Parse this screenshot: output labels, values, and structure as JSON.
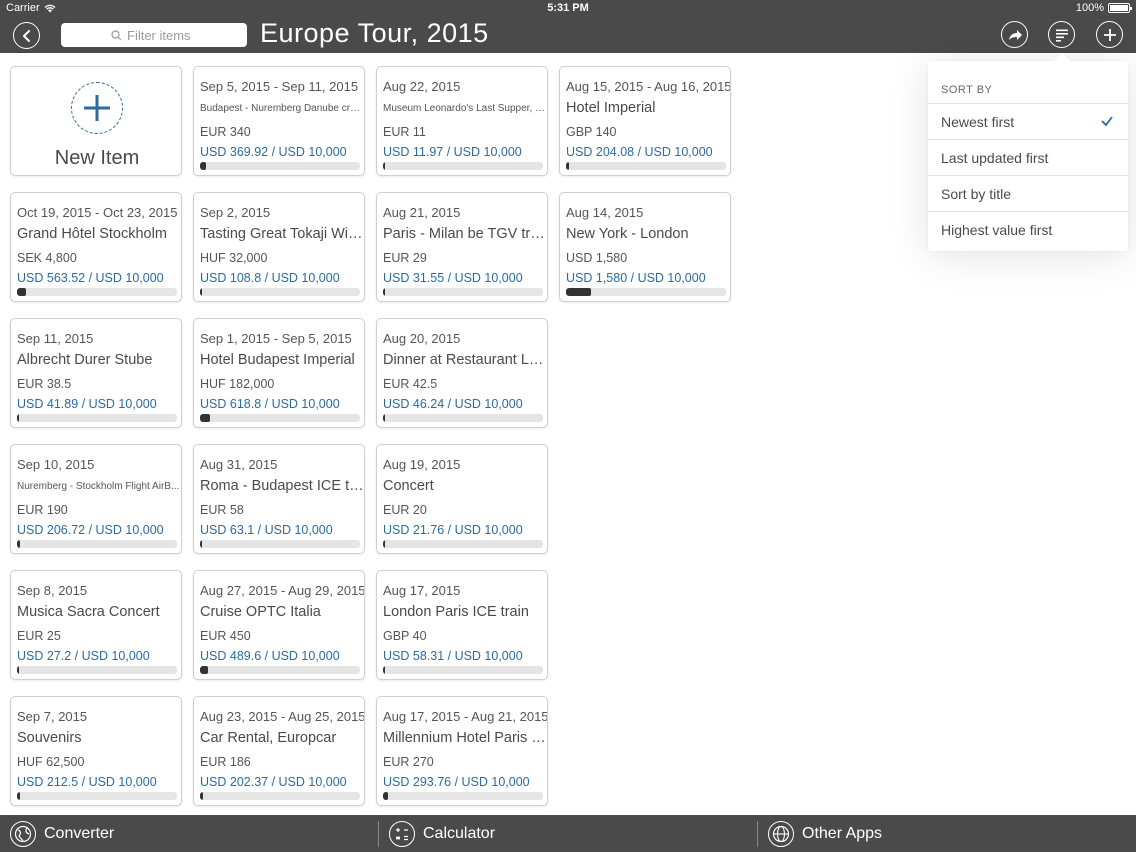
{
  "status_bar": {
    "carrier": "Carrier",
    "time": "5:31 PM",
    "battery": "100%"
  },
  "nav": {
    "title": "Europe Tour, 2015",
    "filter_placeholder": "Filter items"
  },
  "new_item_label": "New Item",
  "items": [
    {
      "date": "Sep 5, 2015 - Sep 11, 2015",
      "title": "Budapest - Nuremberg Danube cruise",
      "amount": "EUR 340",
      "usd": "USD 369.92 / USD 10,000",
      "progress": 0.037
    },
    {
      "date": "Aug 22, 2015",
      "title": "Museum Leonardo's Last Supper, M...",
      "amount": "EUR 11",
      "usd": "USD 11.97 / USD 10,000",
      "progress": 0.0012
    },
    {
      "date": "Aug 15, 2015 - Aug 16, 2015",
      "title": "Hotel Imperial",
      "amount": "GBP 140",
      "usd": "USD 204.08 / USD 10,000",
      "progress": 0.0204
    },
    {
      "date": "Oct 19, 2015 - Oct 23, 2015",
      "title": "Grand Hôtel Stockholm",
      "amount": "SEK 4,800",
      "usd": "USD 563.52 / USD 10,000",
      "progress": 0.0564
    },
    {
      "date": "Sep 2, 2015",
      "title": "Tasting Great Tokaji Wine",
      "amount": "HUF 32,000",
      "usd": "USD 108.8 / USD 10,000",
      "progress": 0.0109
    },
    {
      "date": "Aug 21, 2015",
      "title": "Paris - Milan be TGV train",
      "amount": "EUR 29",
      "usd": "USD 31.55 / USD 10,000",
      "progress": 0.0032
    },
    {
      "date": "Aug 14, 2015",
      "title": "New York - London",
      "amount": "USD 1,580",
      "usd": "USD 1,580 / USD 10,000",
      "progress": 0.158
    },
    {
      "date": "Sep 11, 2015",
      "title": "Albrecht Durer Stube",
      "amount": "EUR 38.5",
      "usd": "USD 41.89 / USD 10,000",
      "progress": 0.0042
    },
    {
      "date": "Sep 1, 2015 - Sep 5, 2015",
      "title": "Hotel Budapest Imperial",
      "amount": "HUF 182,000",
      "usd": "USD 618.8 / USD 10,000",
      "progress": 0.0619
    },
    {
      "date": "Aug 20, 2015",
      "title": "Dinner at Restaurant Lasserre",
      "amount": "EUR 42.5",
      "usd": "USD 46.24 / USD 10,000",
      "progress": 0.0046
    },
    {
      "date": "Sep 10, 2015",
      "title": "Nuremberg - Stockholm Flight AirB...",
      "amount": "EUR 190",
      "usd": "USD 206.72 / USD 10,000",
      "progress": 0.0207
    },
    {
      "date": "Aug 31, 2015",
      "title": "Roma - Budapest ICE train",
      "amount": "EUR 58",
      "usd": "USD 63.1 / USD 10,000",
      "progress": 0.0063
    },
    {
      "date": "Aug 19, 2015",
      "title": "Concert",
      "amount": "EUR 20",
      "usd": "USD 21.76 / USD 10,000",
      "progress": 0.0022
    },
    {
      "date": "Sep 8, 2015",
      "title": "Musica Sacra Concert",
      "amount": "EUR 25",
      "usd": "USD 27.2 / USD 10,000",
      "progress": 0.0027
    },
    {
      "date": "Aug 27, 2015 - Aug 29, 2015",
      "title": "Cruise OPTC Italia",
      "amount": "EUR 450",
      "usd": "USD 489.6 / USD 10,000",
      "progress": 0.049
    },
    {
      "date": "Aug 17, 2015",
      "title": "London Paris ICE train",
      "amount": "GBP 40",
      "usd": "USD 58.31 / USD 10,000",
      "progress": 0.0058
    },
    {
      "date": "Sep 7, 2015",
      "title": "Souvenirs",
      "amount": "HUF 62,500",
      "usd": "USD 212.5 / USD 10,000",
      "progress": 0.0213
    },
    {
      "date": "Aug 23, 2015 - Aug 25, 2015",
      "title": "Car Rental, Europcar",
      "amount": "EUR 186",
      "usd": "USD 202.37 / USD 10,000",
      "progress": 0.0202
    },
    {
      "date": "Aug 17, 2015 - Aug 21, 2015",
      "title": "Millennium Hotel Paris Opera",
      "amount": "EUR 270",
      "usd": "USD 293.76 / USD 10,000",
      "progress": 0.0294
    }
  ],
  "sort_menu": {
    "header": "SORT BY",
    "options": [
      "Newest first",
      "Last updated first",
      "Sort by title",
      "Highest value first"
    ],
    "selected_index": 0
  },
  "tabs": [
    {
      "label": "Converter",
      "icon": "globe-icon"
    },
    {
      "label": "Calculator",
      "icon": "calculator-icon"
    },
    {
      "label": "Other Apps",
      "icon": "globe-icon"
    }
  ],
  "colors": {
    "bar": "#4a4a4a",
    "accent": "#2c6aa0",
    "progress_fill": "#333333"
  }
}
